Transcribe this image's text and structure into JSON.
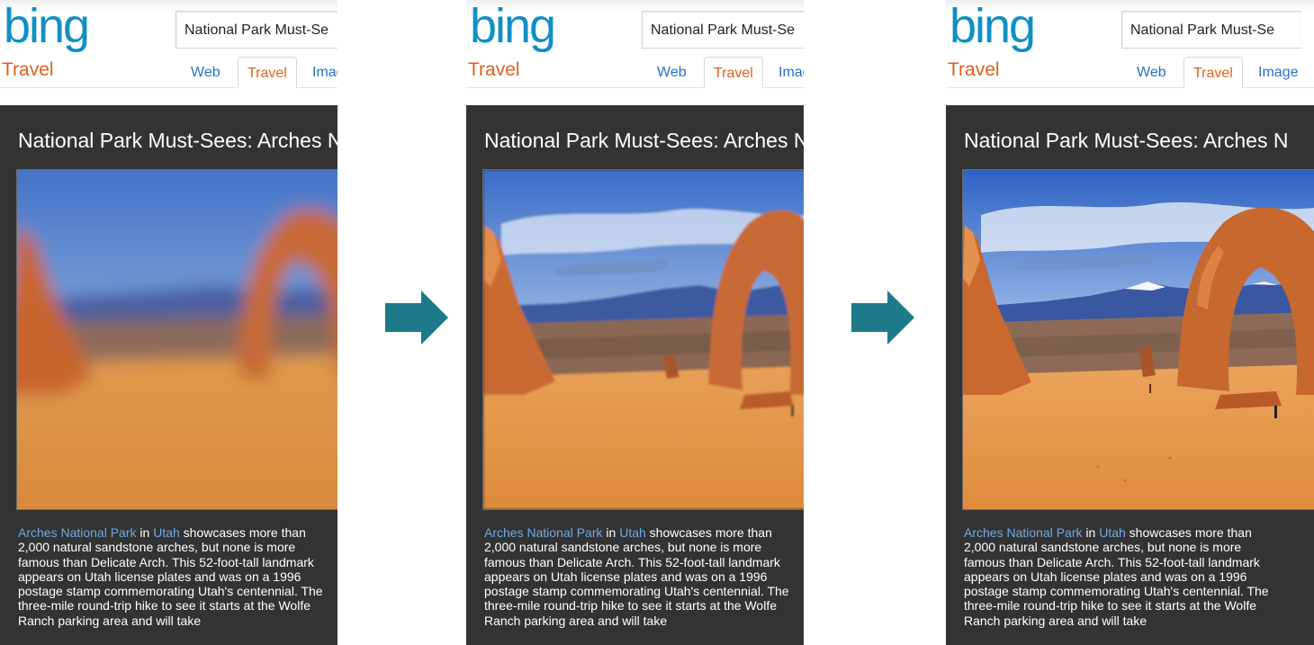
{
  "panels": [
    {
      "logo": "bing",
      "vertical": "Travel",
      "search_query": "National Park Must-Se",
      "tabs": [
        "Web",
        "Travel",
        "Image"
      ],
      "title": "National Park Must-Sees: Arches N",
      "image_quality": "blurry",
      "desc_link1": "Arches National Park",
      "desc_in": " in ",
      "desc_link2": "Utah",
      "desc_text": " showcases more than 2,000 natural sandstone arches, but none is more famous than Delicate Arch. This 52-foot-tall landmark appears on Utah license plates and was on a 1996 postage stamp commemorating Utah's centennial. The three-mile round-trip hike to see it starts at the Wolfe Ranch parking area and will take"
    },
    {
      "logo": "bing",
      "vertical": "Travel",
      "search_query": "National Park Must-Se",
      "tabs": [
        "Web",
        "Travel",
        "Image"
      ],
      "title": "National Park Must-Sees: Arches N",
      "image_quality": "painterly",
      "desc_link1": "Arches National Park",
      "desc_in": " in ",
      "desc_link2": "Utah",
      "desc_text": " showcases more than 2,000 natural sandstone arches, but none is more famous than Delicate Arch. This 52-foot-tall landmark appears on Utah license plates and was on a 1996 postage stamp commemorating Utah's centennial. The three-mile round-trip hike to see it starts at the Wolfe Ranch parking area and will take"
    },
    {
      "logo": "bing",
      "vertical": "Travel",
      "search_query": "National Park Must-Se",
      "tabs": [
        "Web",
        "Travel",
        "Image"
      ],
      "title": "National Park Must-Sees: Arches N",
      "image_quality": "sharp",
      "desc_link1": "Arches National Park",
      "desc_in": " in ",
      "desc_link2": "Utah",
      "desc_text": " showcases more than 2,000 natural sandstone arches, but none is more famous than Delicate Arch. This 52-foot-tall landmark appears on Utah license plates and was on a 1996 postage stamp commemorating Utah's centennial. The three-mile round-trip hike to see it starts at the Wolfe Ranch parking area and will take"
    }
  ],
  "colors": {
    "logo_blue": "#0f8fc6",
    "travel_orange": "#e0611c",
    "link_blue": "#2a6fc9",
    "dark_bg": "#333333",
    "desc_link": "#6fa8e8",
    "arrow_teal": "#1c7a8a"
  },
  "arrow_icon": "right-arrow-icon"
}
